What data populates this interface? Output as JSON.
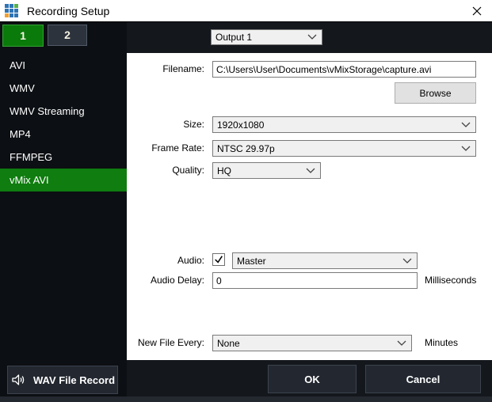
{
  "window": {
    "title": "Recording Setup"
  },
  "tabs": [
    {
      "label": "1",
      "selected": true
    },
    {
      "label": "2",
      "selected": false
    }
  ],
  "output_select": {
    "value": "Output 1"
  },
  "sidebar": {
    "items": [
      {
        "label": "AVI",
        "selected": false
      },
      {
        "label": "WMV",
        "selected": false
      },
      {
        "label": "WMV Streaming",
        "selected": false
      },
      {
        "label": "MP4",
        "selected": false
      },
      {
        "label": "FFMPEG",
        "selected": false
      },
      {
        "label": "vMix AVI",
        "selected": true
      }
    ]
  },
  "form": {
    "filename": {
      "label": "Filename:",
      "value": "C:\\Users\\User\\Documents\\vMixStorage\\capture.avi"
    },
    "browse_button": "Browse",
    "size": {
      "label": "Size:",
      "value": "1920x1080"
    },
    "frame_rate": {
      "label": "Frame Rate:",
      "value": "NTSC 29.97p"
    },
    "quality": {
      "label": "Quality:",
      "value": "HQ"
    },
    "audio": {
      "label": "Audio:",
      "checked": true,
      "value": "Master"
    },
    "audio_delay": {
      "label": "Audio Delay:",
      "value": "0",
      "unit": "Milliseconds"
    },
    "new_file_every": {
      "label": "New File Every:",
      "value": "None",
      "unit": "Minutes"
    }
  },
  "footer": {
    "wav_button": "WAV File Record",
    "ok": "OK",
    "cancel": "Cancel"
  },
  "colors": {
    "accent_green": "#0a7b0a",
    "selected_green": "#0f7d0f",
    "logo_blue": "#2e74b5",
    "logo_green": "#55b04e",
    "logo_orange": "#f0a030",
    "dark_bg": "#14181d",
    "sidebar_bg": "#0c0f13",
    "button_bg": "#232830",
    "titlebar_bg": "#ffffff"
  }
}
